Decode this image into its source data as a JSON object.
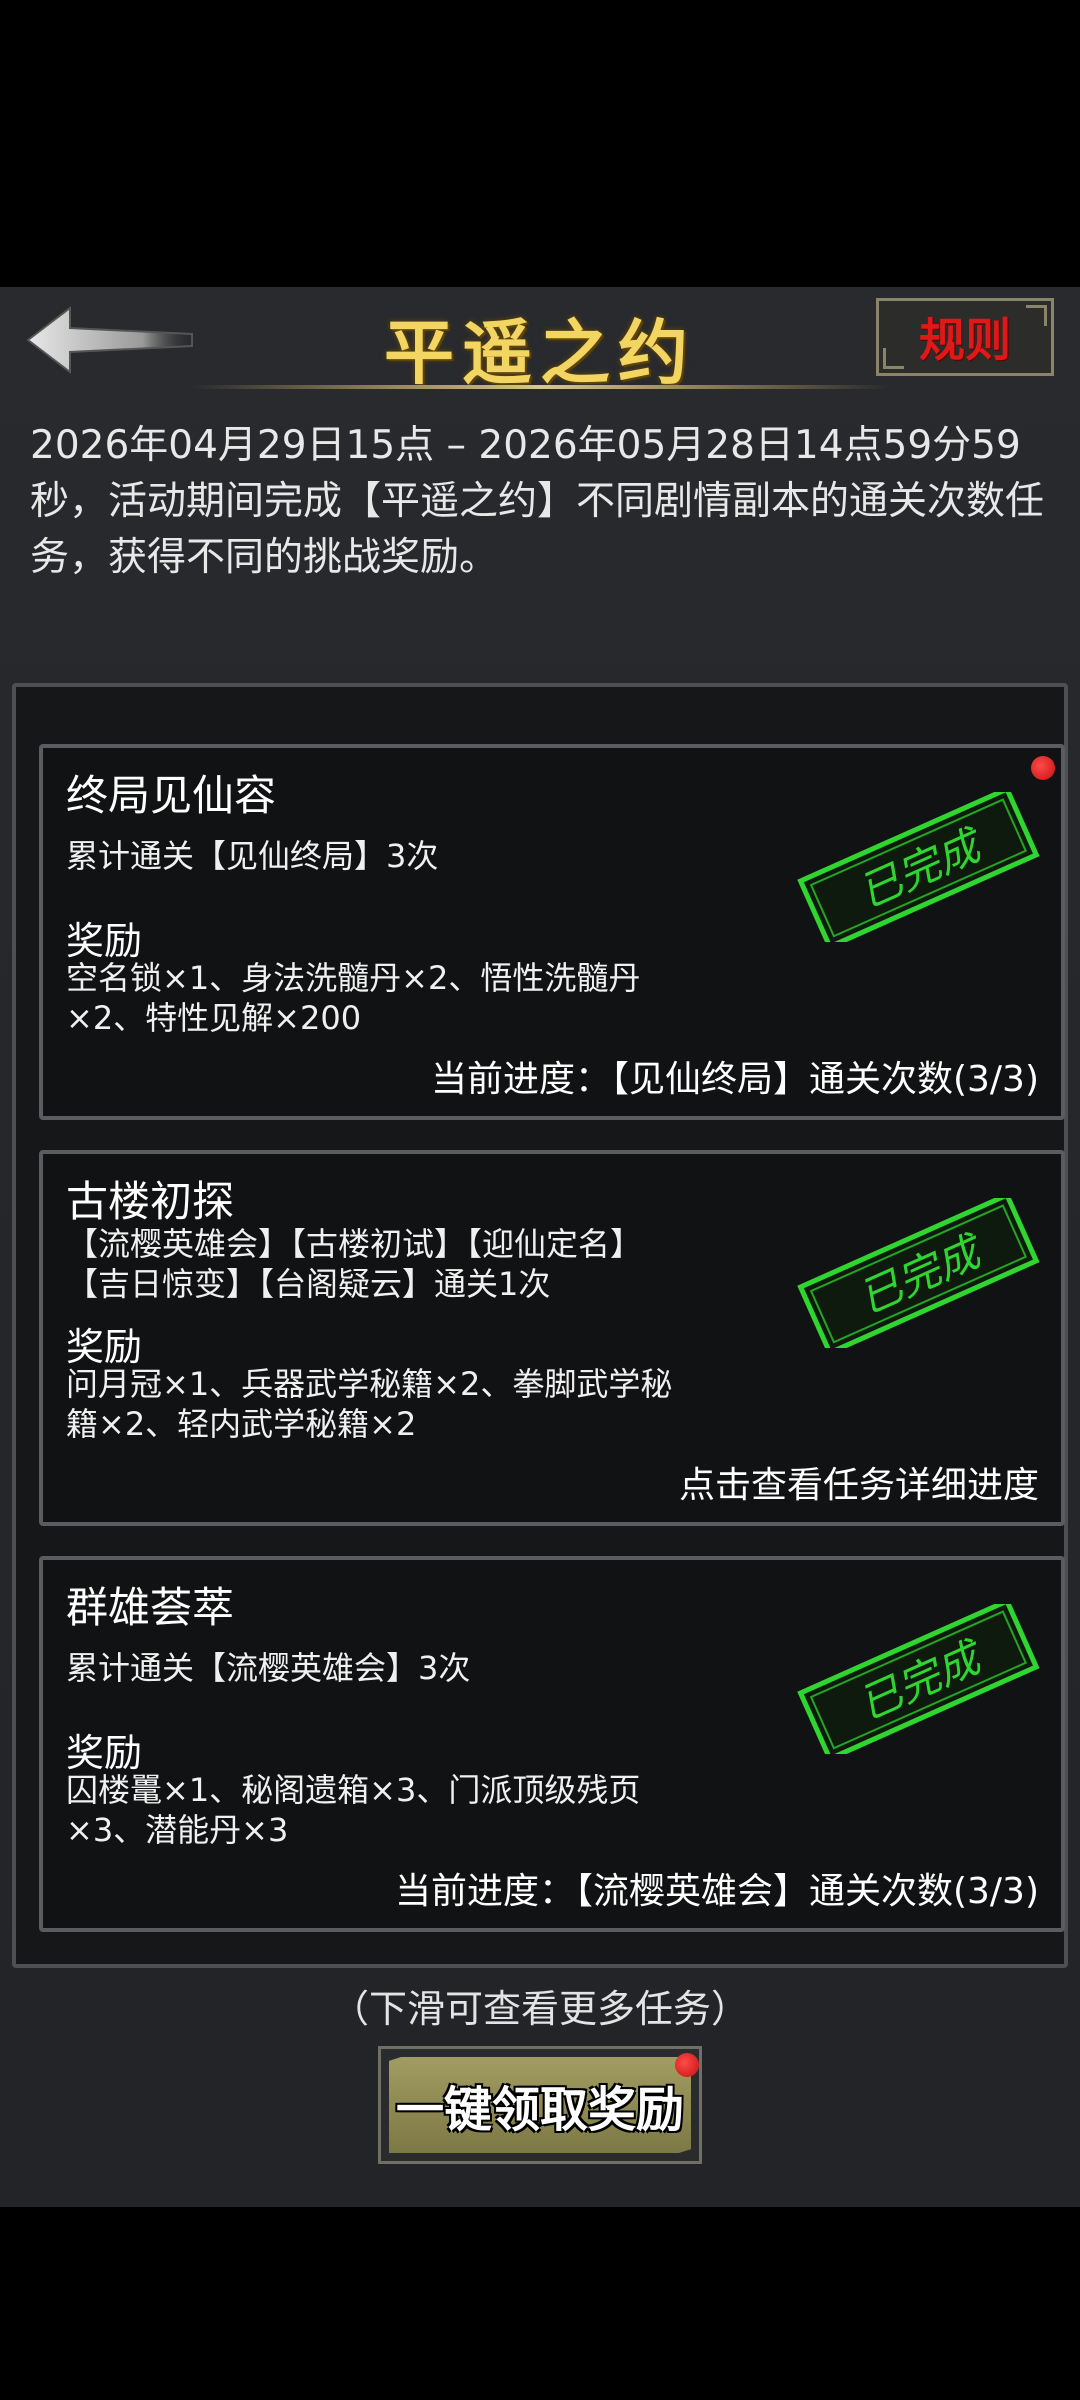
{
  "header": {
    "title": "平遥之约",
    "rules_label": "规则",
    "back_icon": "back-arrow-icon"
  },
  "intro": "2026年04月29日15点 – 2026年05月28日14点59分59秒，活动期间完成【平遥之约】不同剧情副本的通关次数任务，获得不同的挑战奖励。",
  "tasks": [
    {
      "title": "终局见仙容",
      "requirement_lines": [
        "累计通关【见仙终局】3次"
      ],
      "reward_heading": "奖励",
      "reward_lines": [
        "空名锁×1、身法洗髓丹×2、悟性洗髓丹",
        "×2、特性见解×200"
      ],
      "progress": "当前进度：【见仙终局】通关次数(3/3)",
      "stamp": "已完成",
      "has_red_dot": true
    },
    {
      "title": "古楼初探",
      "requirement_lines": [
        "【流樱英雄会】【古楼初试】【迎仙定名】",
        "【吉日惊变】【台阁疑云】通关1次"
      ],
      "reward_heading": "奖励",
      "reward_lines": [
        "问月冠×1、兵器武学秘籍×2、拳脚武学秘",
        "籍×2、轻内武学秘籍×2"
      ],
      "progress": "点击查看任务详细进度",
      "stamp": "已完成",
      "has_red_dot": false
    },
    {
      "title": "群雄荟萃",
      "requirement_lines": [
        "累计通关【流樱英雄会】3次"
      ],
      "reward_heading": "奖励",
      "reward_lines": [
        "囚楼鼍×1、秘阁遗箱×3、门派顶级残页",
        "×3、潜能丹×3"
      ],
      "progress": "当前进度：【流樱英雄会】通关次数(3/3)",
      "stamp": "已完成",
      "has_red_dot": false
    }
  ],
  "scroll_hint": "（下滑可查看更多任务）",
  "claim_button": "一键领取奖励",
  "colors": {
    "title_gold": "#f3d561",
    "rules_red": "#e01818",
    "stamp_green": "#2fd62f",
    "claim_olive": "#8f8a52"
  }
}
